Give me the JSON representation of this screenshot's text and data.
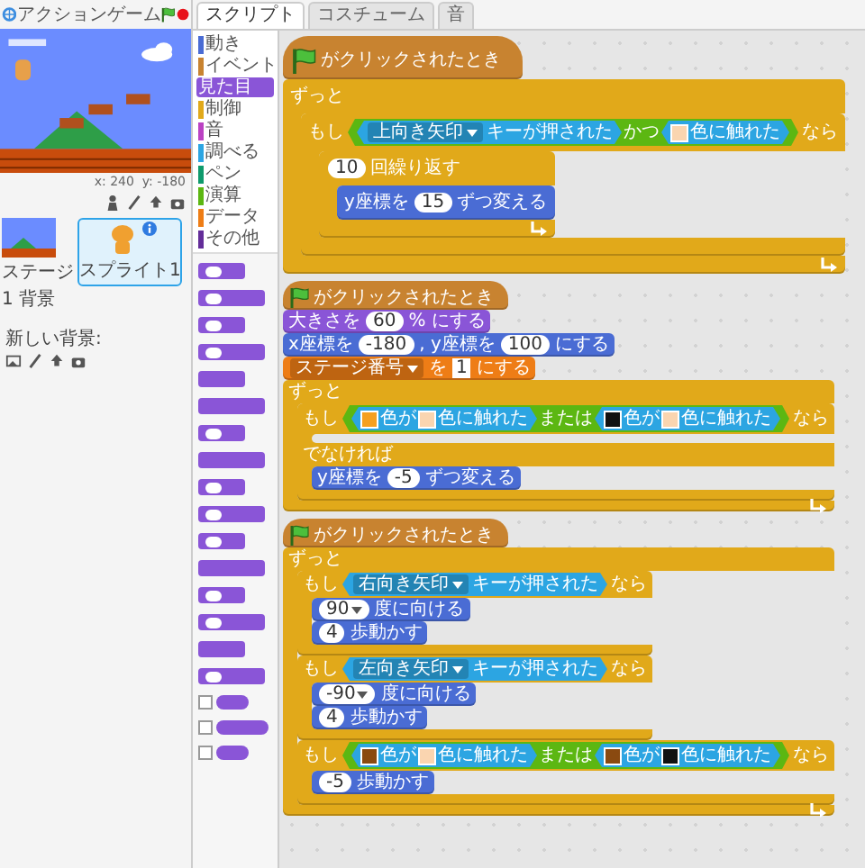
{
  "app": {
    "title": "アクションゲーム"
  },
  "stage": {
    "mouse": "x: 240  y: -180"
  },
  "sprites_panel": {
    "stage_label": "ステージ",
    "backdrop_count": "1 背景",
    "new_backdrop_label": "新しい背景:",
    "sprites": [
      {
        "name": "スプライト1",
        "selected": true
      }
    ]
  },
  "tabs": [
    {
      "label": "スクリプト",
      "selected": true
    },
    {
      "label": "コスチューム",
      "selected": false
    },
    {
      "label": "音",
      "selected": false
    }
  ],
  "categories": [
    {
      "label": "動き",
      "color": "#4a6cd4",
      "selected": false
    },
    {
      "label": "イベント",
      "color": "#c88330",
      "selected": false
    },
    {
      "label": "見た目",
      "color": "#8a55d7",
      "selected": true
    },
    {
      "label": "制御",
      "color": "#e1a91a",
      "selected": false
    },
    {
      "label": "音",
      "color": "#bb42c3",
      "selected": false
    },
    {
      "label": "調べる",
      "color": "#2ca5e2",
      "selected": false
    },
    {
      "label": "ペン",
      "color": "#0e9a6c",
      "selected": false
    },
    {
      "label": "演算",
      "color": "#5cb712",
      "selected": false
    },
    {
      "label": "データ",
      "color": "#ee7d16",
      "selected": false
    },
    {
      "label": "その他",
      "color": "#632d99",
      "selected": false
    }
  ],
  "palette": [
    {
      "kind": "stack_input"
    },
    {
      "kind": "stack_input"
    },
    {
      "kind": "stack_input"
    },
    {
      "kind": "stack_input"
    },
    {
      "kind": "stack"
    },
    {
      "kind": "stack"
    },
    {
      "kind": "stack_input"
    },
    {
      "kind": "stack"
    },
    {
      "kind": "stack_input"
    },
    {
      "kind": "stack_input"
    },
    {
      "kind": "stack_input"
    },
    {
      "kind": "stack"
    },
    {
      "kind": "stack_input"
    },
    {
      "kind": "stack_input"
    },
    {
      "kind": "stack"
    },
    {
      "kind": "stack_input"
    },
    {
      "kind": "reporter",
      "checked": false
    },
    {
      "kind": "reporter",
      "checked": false
    },
    {
      "kind": "reporter",
      "checked": false
    }
  ],
  "scripts": [
    {
      "blocks": [
        {
          "kind": "hat",
          "color": "#c88330",
          "parts": [
            {
              "kind": "flag"
            },
            {
              "kind": "text",
              "text": "がクリックされたとき"
            }
          ]
        },
        {
          "kind": "loop",
          "color": "#e1a91a",
          "parts": [
            {
              "kind": "text",
              "text": "ずっと"
            }
          ],
          "body": [
            {
              "kind": "if",
              "color": "#e1a91a",
              "parts": [
                {
                  "kind": "text",
                  "text": "もし"
                },
                {
                  "kind": "bool",
                  "color": "#5cb712",
                  "parts": [
                    {
                      "kind": "bool",
                      "color": "#2ca5e2",
                      "parts": [
                        {
                          "kind": "dropdown",
                          "text": "上向き矢印"
                        },
                        {
                          "kind": "text",
                          "text": "キーが押された"
                        }
                      ]
                    },
                    {
                      "kind": "text",
                      "text": "かつ"
                    },
                    {
                      "kind": "bool",
                      "color": "#2ca5e2",
                      "parts": [
                        {
                          "kind": "color",
                          "color": "#fad5b0"
                        },
                        {
                          "kind": "text",
                          "text": "色に触れた"
                        }
                      ]
                    }
                  ]
                },
                {
                  "kind": "text",
                  "text": "なら"
                }
              ],
              "body": [
                {
                  "kind": "loop",
                  "color": "#e1a91a",
                  "parts": [
                    {
                      "kind": "number",
                      "text": "10"
                    },
                    {
                      "kind": "text",
                      "text": "回繰り返す"
                    }
                  ],
                  "body": [
                    {
                      "kind": "stack",
                      "color": "#4a6cd4",
                      "parts": [
                        {
                          "kind": "text",
                          "text": "y座標を"
                        },
                        {
                          "kind": "number",
                          "text": "15"
                        },
                        {
                          "kind": "text",
                          "text": "ずつ変える"
                        }
                      ]
                    }
                  ]
                }
              ]
            }
          ]
        }
      ]
    },
    {
      "blocks": [
        {
          "kind": "hat",
          "color": "#c88330",
          "parts": [
            {
              "kind": "flag"
            },
            {
              "kind": "text",
              "text": "がクリックされたとき"
            }
          ]
        },
        {
          "kind": "stack",
          "color": "#8a55d7",
          "parts": [
            {
              "kind": "text",
              "text": "大きさを"
            },
            {
              "kind": "number",
              "text": "60"
            },
            {
              "kind": "text",
              "text": "% にする"
            }
          ]
        },
        {
          "kind": "stack",
          "color": "#4a6cd4",
          "parts": [
            {
              "kind": "text",
              "text": "x座標を"
            },
            {
              "kind": "number",
              "text": "-180"
            },
            {
              "kind": "text",
              "text": ", y座標を"
            },
            {
              "kind": "number",
              "text": "100"
            },
            {
              "kind": "text",
              "text": "にする"
            }
          ]
        },
        {
          "kind": "stack",
          "color": "#ee7d16",
          "parts": [
            {
              "kind": "dropdown",
              "text": "ステージ番号"
            },
            {
              "kind": "text",
              "text": "を"
            },
            {
              "kind": "string",
              "text": "1"
            },
            {
              "kind": "text",
              "text": "にする"
            }
          ]
        },
        {
          "kind": "loop",
          "color": "#e1a91a",
          "parts": [
            {
              "kind": "text",
              "text": "ずっと"
            }
          ],
          "body": [
            {
              "kind": "ifelse",
              "color": "#e1a91a",
              "parts": [
                {
                  "kind": "text",
                  "text": "もし"
                },
                {
                  "kind": "bool",
                  "color": "#5cb712",
                  "parts": [
                    {
                      "kind": "bool",
                      "color": "#2ca5e2",
                      "parts": [
                        {
                          "kind": "color",
                          "color": "#f5a020"
                        },
                        {
                          "kind": "text",
                          "text": "色が"
                        },
                        {
                          "kind": "color",
                          "color": "#fad5b0"
                        },
                        {
                          "kind": "text",
                          "text": "色に触れた"
                        }
                      ]
                    },
                    {
                      "kind": "text",
                      "text": "または"
                    },
                    {
                      "kind": "bool",
                      "color": "#2ca5e2",
                      "parts": [
                        {
                          "kind": "color",
                          "color": "#111111"
                        },
                        {
                          "kind": "text",
                          "text": "色が"
                        },
                        {
                          "kind": "color",
                          "color": "#fad5b0"
                        },
                        {
                          "kind": "text",
                          "text": "色に触れた"
                        }
                      ]
                    }
                  ]
                },
                {
                  "kind": "text",
                  "text": "なら"
                }
              ],
              "else_parts": [
                {
                  "kind": "text",
                  "text": "でなければ"
                }
              ],
              "else_body": [
                {
                  "kind": "stack",
                  "color": "#4a6cd4",
                  "parts": [
                    {
                      "kind": "text",
                      "text": "y座標を"
                    },
                    {
                      "kind": "number",
                      "text": "-5"
                    },
                    {
                      "kind": "text",
                      "text": "ずつ変える"
                    }
                  ]
                }
              ]
            }
          ]
        }
      ]
    },
    {
      "blocks": [
        {
          "kind": "hat",
          "color": "#c88330",
          "parts": [
            {
              "kind": "flag"
            },
            {
              "kind": "text",
              "text": "がクリックされたとき"
            }
          ]
        },
        {
          "kind": "loop",
          "color": "#e1a91a",
          "parts": [
            {
              "kind": "text",
              "text": "ずっと"
            }
          ],
          "body": [
            {
              "kind": "if",
              "color": "#e1a91a",
              "parts": [
                {
                  "kind": "text",
                  "text": "もし"
                },
                {
                  "kind": "bool",
                  "color": "#2ca5e2",
                  "parts": [
                    {
                      "kind": "dropdown",
                      "text": "右向き矢印"
                    },
                    {
                      "kind": "text",
                      "text": "キーが押された"
                    }
                  ]
                },
                {
                  "kind": "text",
                  "text": "なら"
                }
              ],
              "body": [
                {
                  "kind": "stack",
                  "color": "#4a6cd4",
                  "parts": [
                    {
                      "kind": "numdrop",
                      "text": "90"
                    },
                    {
                      "kind": "text",
                      "text": "度に向ける"
                    }
                  ]
                },
                {
                  "kind": "stack",
                  "color": "#4a6cd4",
                  "parts": [
                    {
                      "kind": "number",
                      "text": "4"
                    },
                    {
                      "kind": "text",
                      "text": "歩動かす"
                    }
                  ]
                }
              ]
            },
            {
              "kind": "if",
              "color": "#e1a91a",
              "parts": [
                {
                  "kind": "text",
                  "text": "もし"
                },
                {
                  "kind": "bool",
                  "color": "#2ca5e2",
                  "parts": [
                    {
                      "kind": "dropdown",
                      "text": "左向き矢印"
                    },
                    {
                      "kind": "text",
                      "text": "キーが押された"
                    }
                  ]
                },
                {
                  "kind": "text",
                  "text": "なら"
                }
              ],
              "body": [
                {
                  "kind": "stack",
                  "color": "#4a6cd4",
                  "parts": [
                    {
                      "kind": "numdrop",
                      "text": "-90"
                    },
                    {
                      "kind": "text",
                      "text": "度に向ける"
                    }
                  ]
                },
                {
                  "kind": "stack",
                  "color": "#4a6cd4",
                  "parts": [
                    {
                      "kind": "number",
                      "text": "4"
                    },
                    {
                      "kind": "text",
                      "text": "歩動かす"
                    }
                  ]
                }
              ]
            },
            {
              "kind": "if",
              "color": "#e1a91a",
              "parts": [
                {
                  "kind": "text",
                  "text": "もし"
                },
                {
                  "kind": "bool",
                  "color": "#5cb712",
                  "parts": [
                    {
                      "kind": "bool",
                      "color": "#2ca5e2",
                      "parts": [
                        {
                          "kind": "color",
                          "color": "#8a4a10"
                        },
                        {
                          "kind": "text",
                          "text": "色が"
                        },
                        {
                          "kind": "color",
                          "color": "#fad5b0"
                        },
                        {
                          "kind": "text",
                          "text": "色に触れた"
                        }
                      ]
                    },
                    {
                      "kind": "text",
                      "text": "または"
                    },
                    {
                      "kind": "bool",
                      "color": "#2ca5e2",
                      "parts": [
                        {
                          "kind": "color",
                          "color": "#8a4a10"
                        },
                        {
                          "kind": "text",
                          "text": "色が"
                        },
                        {
                          "kind": "color",
                          "color": "#111111"
                        },
                        {
                          "kind": "text",
                          "text": "色に触れた"
                        }
                      ]
                    }
                  ]
                },
                {
                  "kind": "text",
                  "text": "なら"
                }
              ],
              "body": [
                {
                  "kind": "stack",
                  "color": "#4a6cd4",
                  "parts": [
                    {
                      "kind": "number",
                      "text": "-5"
                    },
                    {
                      "kind": "text",
                      "text": "歩動かす"
                    }
                  ]
                }
              ]
            }
          ]
        }
      ]
    }
  ]
}
